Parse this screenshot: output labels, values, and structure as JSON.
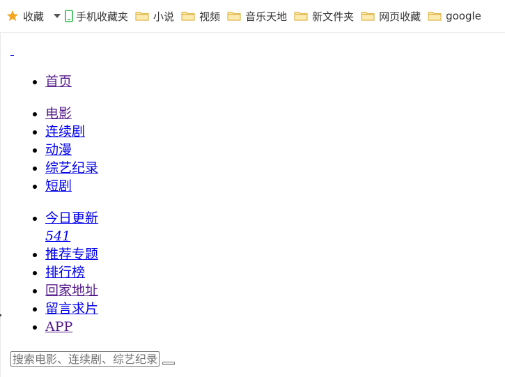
{
  "bookmarks_bar": {
    "favorites_label": "收藏",
    "mobile_favorites_label": "手机收藏夹",
    "folders": [
      "小说",
      "视频",
      "音乐天地",
      "新文件夹",
      "网页收藏",
      "google"
    ]
  },
  "nav_primary": [
    {
      "label": "首页"
    }
  ],
  "nav_categories": [
    {
      "label": "电影"
    },
    {
      "label": "连续剧"
    },
    {
      "label": "动漫"
    },
    {
      "label": "综艺纪录"
    },
    {
      "label": "短剧"
    }
  ],
  "nav_extras": {
    "today_update": {
      "label": "今日更新",
      "count": "541"
    },
    "items": [
      {
        "label": "推荐专题"
      },
      {
        "label": "排行榜"
      },
      {
        "label": "回家地址"
      },
      {
        "label": "留言求片"
      },
      {
        "label": "APP"
      }
    ]
  },
  "search": {
    "placeholder": "搜索电影、连续剧、综艺纪录片、动漫"
  },
  "colors": {
    "link": "#0000ee",
    "visited_link": "#551a8b",
    "star": "#f5a623",
    "folder": "#f8d775",
    "phone_icon": "#2db84d"
  }
}
